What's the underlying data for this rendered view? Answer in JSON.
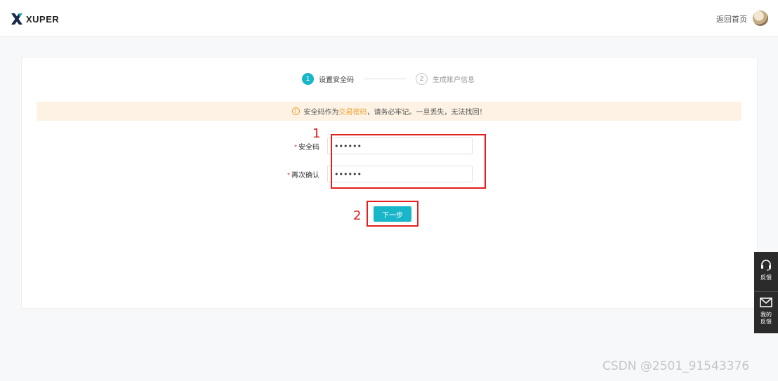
{
  "header": {
    "logo_text": "XUPER",
    "back_home": "返回首页"
  },
  "steps": [
    {
      "num": "1",
      "label": "设置安全码"
    },
    {
      "num": "2",
      "label": "生成账户信息"
    }
  ],
  "notice": {
    "prefix": "安全码作为",
    "highlight": "交易密码",
    "suffix": "，请务必牢记。一旦丢失，无法找回！"
  },
  "form": {
    "security_code": {
      "required_mark": "*",
      "label": "安全码",
      "value": "••••••"
    },
    "confirm_code": {
      "required_mark": "*",
      "label": "再次确认",
      "value": "••••••"
    }
  },
  "next_button": "下一步",
  "annotations": [
    "1",
    "2"
  ],
  "sidebar": {
    "feedback": "反馈",
    "my_feedback_line1": "我的",
    "my_feedback_line2": "反馈"
  },
  "watermark": "CSDN @2501_91543376",
  "colors": {
    "accent": "#19b5c8",
    "notice_bg": "#fdf2e3",
    "warning": "#f0a030",
    "annotation": "#e02020"
  }
}
